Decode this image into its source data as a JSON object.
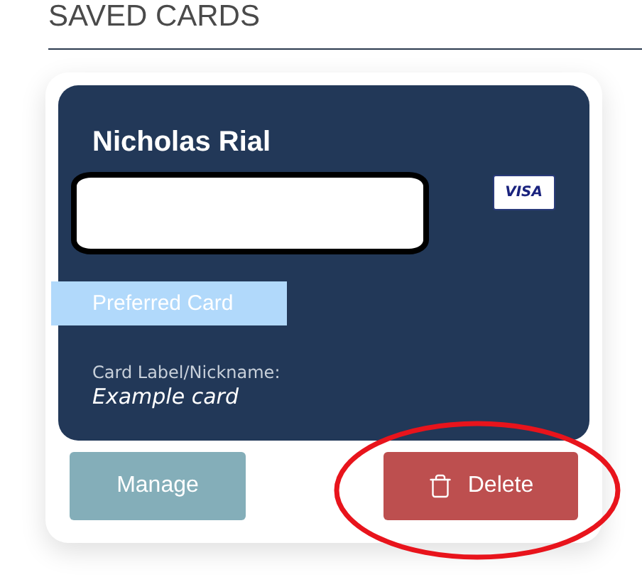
{
  "section_title": "SAVED CARDS",
  "card": {
    "holder_name": "Nicholas Rial",
    "number_redacted": true,
    "brand": "VISA",
    "preferred_badge": "Preferred Card",
    "nickname_label": "Card Label/Nickname:",
    "nickname": "Example card"
  },
  "buttons": [
    {
      "kind": "manage",
      "label": "Manage"
    },
    {
      "kind": "delete",
      "label": "Delete",
      "circled": true
    }
  ]
}
